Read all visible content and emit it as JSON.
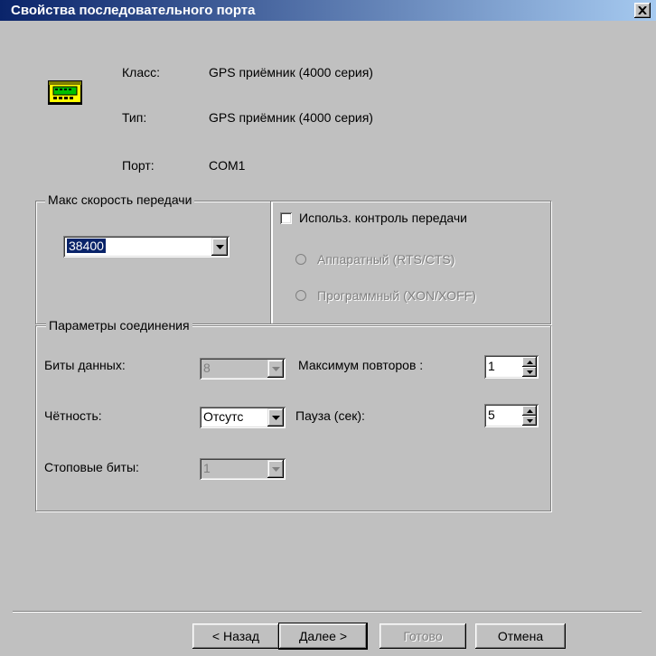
{
  "window": {
    "title": "Свойства последовательного порта"
  },
  "device": {
    "icon": "gps-device-icon",
    "class_label": "Класс:",
    "class_value": "GPS приёмник (4000 серия)",
    "type_label": "Тип:",
    "type_value": "GPS приёмник (4000 серия)",
    "port_label": "Порт:",
    "port_value": "COM1"
  },
  "speed_group": {
    "legend": "Макс скорость передачи",
    "selected": "38400"
  },
  "flow_control": {
    "checkbox_label": "Использ. контроль передачи",
    "checked": false,
    "hardware_label": "Аппаратный (RTS/CTS)",
    "software_label": "Программный (XON/XOFF)"
  },
  "connection": {
    "legend": "Параметры соединения",
    "data_bits_label": "Биты данных:",
    "data_bits_value": "8",
    "parity_label": "Чётность:",
    "parity_value": "Отсутс",
    "stop_bits_label": "Стоповые биты:",
    "stop_bits_value": "1",
    "max_retries_label": "Максимум повторов :",
    "max_retries_value": "1",
    "pause_label": "Пауза (сек):",
    "pause_value": "5"
  },
  "buttons": {
    "back": "< Назад",
    "next": "Далее >",
    "finish": "Готово",
    "cancel": "Отмена"
  },
  "colors": {
    "titlebar": "#0a246a",
    "face": "#c0c0c0",
    "selection": "#0a246a",
    "disabled_text": "#808080"
  }
}
